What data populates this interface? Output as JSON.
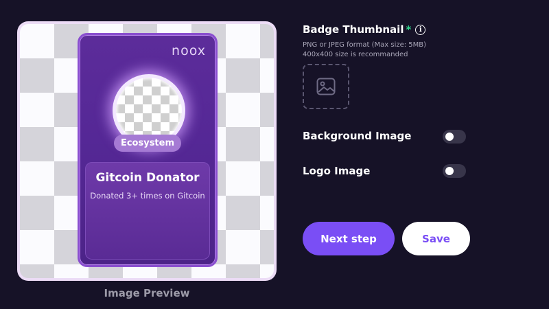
{
  "preview": {
    "brand_logo": "noox",
    "category": "Ecosystem",
    "badge_title": "Gitcoin Donator",
    "badge_description": "Donated 3+ times on Gitcoin",
    "caption": "Image Preview"
  },
  "form": {
    "thumbnail": {
      "label": "Badge Thumbnail",
      "required_mark": "*",
      "info_icon": "info-icon",
      "hint_format": "PNG or JPEG format (Max size: 5MB)",
      "hint_size": "400x400 size is recommanded",
      "upload_icon": "image-icon"
    },
    "background_image": {
      "label": "Background Image",
      "enabled": false
    },
    "logo_image": {
      "label": "Logo Image",
      "enabled": false
    }
  },
  "actions": {
    "next_label": "Next step",
    "save_label": "Save"
  },
  "colors": {
    "page_bg": "#161227",
    "accent": "#7a4ef5",
    "required": "#30d18a",
    "card_purple": "#552896"
  }
}
